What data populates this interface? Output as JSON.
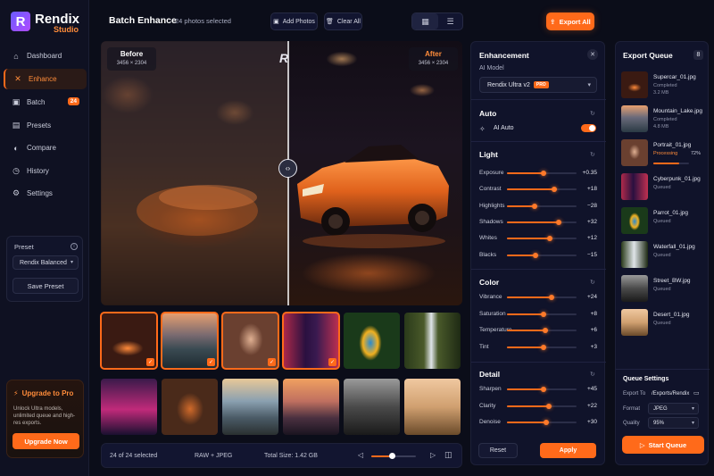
{
  "app": {
    "name": "Rendix",
    "sub": "Studio"
  },
  "sidebar": {
    "items": [
      {
        "label": "Dashboard",
        "icon": "home-icon"
      },
      {
        "label": "Enhance",
        "icon": "enhance-icon",
        "active": true
      },
      {
        "label": "Batch",
        "icon": "batch-icon",
        "badge": "24"
      },
      {
        "label": "Presets",
        "icon": "presets-icon"
      },
      {
        "label": "Compare",
        "icon": "compare-icon"
      },
      {
        "label": "History",
        "icon": "history-icon"
      },
      {
        "label": "Settings",
        "icon": "settings-icon"
      }
    ],
    "preset": {
      "label": "Preset",
      "value": "Rendix Balanced",
      "save": "Save Preset"
    },
    "upgrade": {
      "title": "Upgrade to Pro",
      "desc": "Unlock Ultra models, unlimited queue and high-res exports.",
      "button": "Upgrade Now"
    }
  },
  "header": {
    "title": "Batch Enhance",
    "subtitle": "24 photos selected",
    "add_photos": "Add Photos",
    "clear_all": "Clear All",
    "export_all": "Export All"
  },
  "preview": {
    "before_label": "Before",
    "before_dims": "3456 × 2304",
    "after_label": "After",
    "after_dims": "3456 × 2304",
    "split": 0.52
  },
  "bottom": {
    "selected": "24 of 24 selected",
    "format": "RAW + JPEG",
    "total_size": "Total Size: 1.42 GB"
  },
  "enhancement": {
    "title": "Enhancement",
    "ai_model_label": "AI Model",
    "ai_model_value": "Rendix Ultra v2",
    "pro_badge": "PRO",
    "auto_section": "Auto",
    "ai_auto_label": "AI Auto",
    "ai_auto_on": true,
    "light_section": "Light",
    "light": [
      {
        "label": "Exposure",
        "value": "+0.35",
        "pos": 0.53
      },
      {
        "label": "Contrast",
        "value": "+18",
        "pos": 0.68
      },
      {
        "label": "Highlights",
        "value": "−28",
        "pos": 0.4
      },
      {
        "label": "Shadows",
        "value": "+32",
        "pos": 0.74
      },
      {
        "label": "Whites",
        "value": "+12",
        "pos": 0.61
      },
      {
        "label": "Blacks",
        "value": "−15",
        "pos": 0.41
      }
    ],
    "color_section": "Color",
    "color": [
      {
        "label": "Vibrance",
        "value": "+24",
        "pos": 0.64
      },
      {
        "label": "Saturation",
        "value": "+8",
        "pos": 0.53
      },
      {
        "label": "Temperature",
        "value": "+6",
        "pos": 0.55
      },
      {
        "label": "Tint",
        "value": "+3",
        "pos": 0.52
      }
    ],
    "detail_section": "Detail",
    "detail": [
      {
        "label": "Sharpen",
        "value": "+45",
        "pos": 0.53
      },
      {
        "label": "Clarity",
        "value": "+22",
        "pos": 0.6
      },
      {
        "label": "Denoise",
        "value": "+30",
        "pos": 0.57
      }
    ],
    "reset": "Reset",
    "apply": "Apply"
  },
  "queue": {
    "title": "Export Queue",
    "count": "8",
    "items": [
      {
        "name": "Supercar_01.jpg",
        "status": "Completed",
        "size": "3.2 MB"
      },
      {
        "name": "Mountain_Lake.jpg",
        "status": "Completed",
        "size": "4.8 MB"
      },
      {
        "name": "Portrait_01.jpg",
        "status": "Processing",
        "pct": "72%",
        "progress": 0.72
      },
      {
        "name": "Cyberpunk_01.jpg",
        "status": "Queued"
      },
      {
        "name": "Parrot_01.jpg",
        "status": "Queued"
      },
      {
        "name": "Waterfall_01.jpg",
        "status": "Queued"
      },
      {
        "name": "Street_BW.jpg",
        "status": "Queued"
      },
      {
        "name": "Desert_01.jpg",
        "status": "Queued"
      }
    ],
    "settings_title": "Queue Settings",
    "export_to_label": "Export To",
    "export_to_value": "/Exports/Rendix",
    "format_label": "Format",
    "format_value": "JPEG",
    "quality_label": "Quality",
    "quality_value": "95%",
    "start": "Start Queue"
  },
  "colors": {
    "accent": "#ff6a1a",
    "bg": "#0b0d19",
    "panel": "#10132a"
  }
}
